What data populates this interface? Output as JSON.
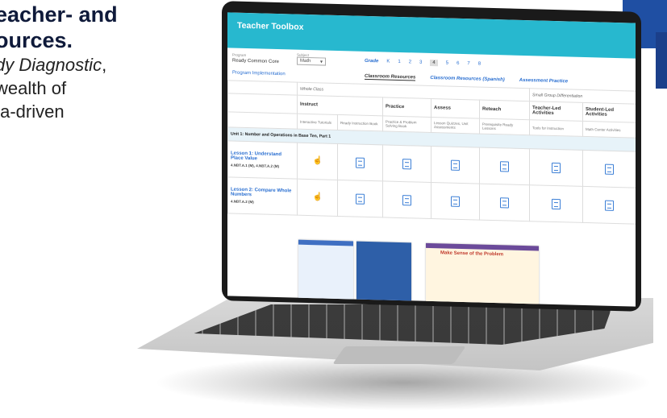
{
  "promo": {
    "line1": "eacher- and",
    "line2": "ources.",
    "line3": "dy Diagnostic",
    "line3_suffix": ",",
    "line4": "wealth of",
    "line5": "ta-driven"
  },
  "toolbox": {
    "title": "Teacher Toolbox",
    "program_label": "Program",
    "program_value": "Ready Common Core",
    "subject_label": "Subject",
    "subject_value": "Math",
    "program_implementation": "Program Implementation",
    "grade_label": "Grade",
    "grades": [
      "K",
      "1",
      "2",
      "3",
      "4",
      "5",
      "6",
      "7",
      "8"
    ],
    "selected_grade": "4",
    "tabs": [
      "Classroom Resources",
      "Classroom Resources (Spanish)",
      "Assessment Practice"
    ],
    "table": {
      "group_headers": [
        "Whole Class",
        "Small Group Differentiation"
      ],
      "columns": [
        "Instruct",
        "Practice",
        "Assess",
        "Reteach",
        "Teacher-Led Activities",
        "Student-Led Activities"
      ],
      "subcolumns": [
        "Interactive Tutorials",
        "Ready Instruction Book",
        "Practice & Problem Solving Book",
        "Lesson Quizzes, Unit Assessments",
        "Prerequisite Ready Lessons",
        "Tools for Instruction",
        "Math Center Activities"
      ],
      "unit": "Unit 1: Number and Operations in Base Ten, Part 1",
      "lessons": [
        {
          "title": "Lesson 1: Understand Place Value",
          "standards": "4.NBT.A.1 (M), 4.NBT.A.2 (M)"
        },
        {
          "title": "Lesson 2: Compare Whole Numbers",
          "standards": "4.NBT.A.2 (M)"
        }
      ]
    },
    "thumb_heading": "Make Sense of the Problem"
  },
  "colors": {
    "header": "#27b8cf",
    "link": "#2a6fd1",
    "unit_row": "#e7f3f9"
  }
}
